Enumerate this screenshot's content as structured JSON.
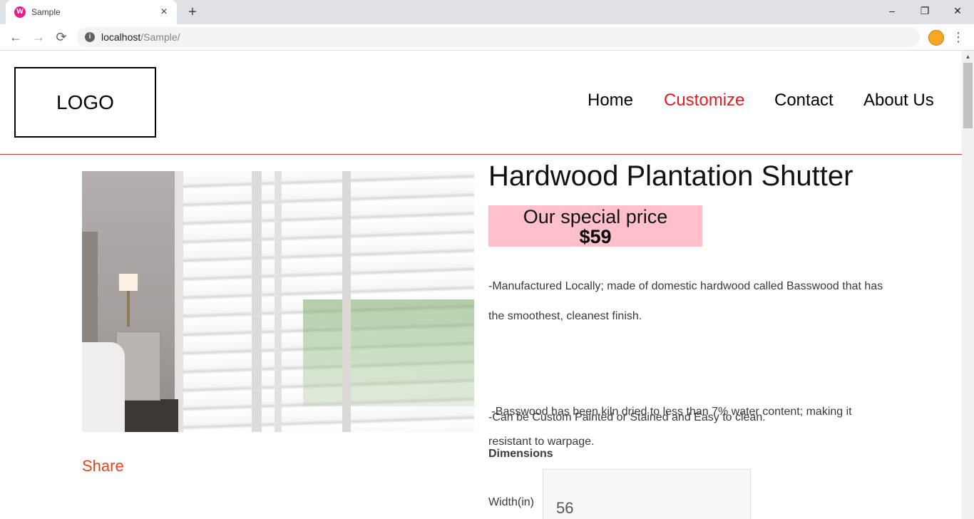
{
  "browser": {
    "tab_title": "Sample",
    "tab_favicon": "W",
    "tab_close": "×",
    "new_tab": "+",
    "url_host": "localhost",
    "url_path": "/Sample/",
    "back_icon": "←",
    "forward_icon": "→",
    "reload_icon": "⟳",
    "minimize_icon": "–",
    "restore_icon": "❐",
    "close_icon": "✕",
    "menu_icon": "⋮"
  },
  "header": {
    "logo": "LOGO",
    "nav": [
      {
        "label": "Home"
      },
      {
        "label": "Customize"
      },
      {
        "label": "Contact"
      },
      {
        "label": "About Us"
      }
    ],
    "active_color": "#e31b23",
    "rule_color": "#c0392b"
  },
  "product": {
    "title": "Hardwood Plantation Shutter",
    "price_label": "Our special price",
    "price": "$59",
    "price_bg": "#ffc0cb",
    "description": [
      "-Manufactured Locally; made of domestic hardwood called Basswood that has the smoothest, cleanest finish.",
      " -Basswood has been kiln dried to less than 7% water content; making it resistant to warpage.",
      "-Can be Custom Painted or Stained and Easy to clean."
    ],
    "dimensions_label": "Dimensions",
    "width_label": "Width(in)",
    "width_value": "56",
    "share_label": "Share",
    "share_color": "#e0471f"
  }
}
